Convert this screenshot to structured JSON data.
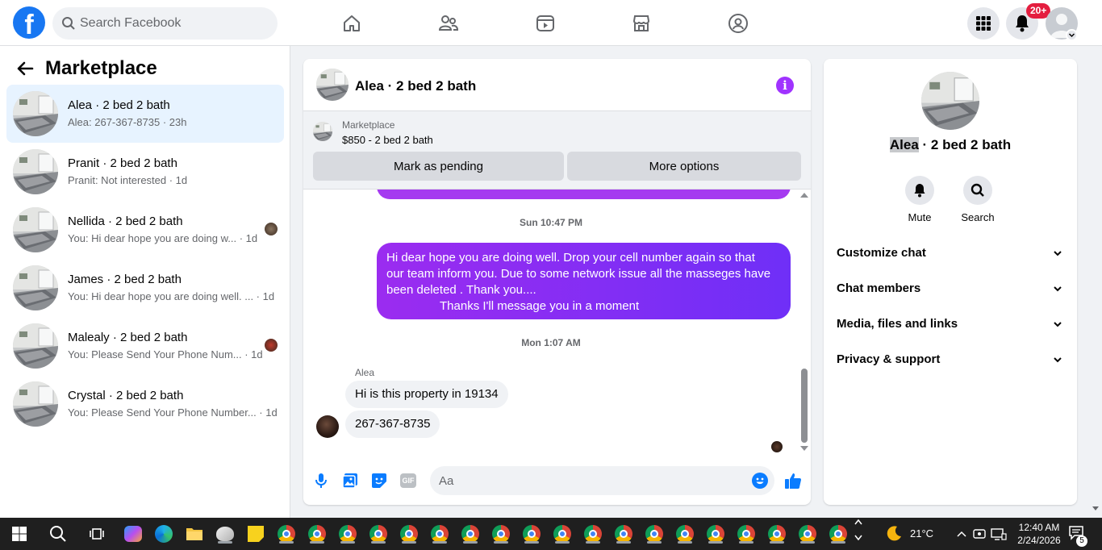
{
  "topbar": {
    "logo_letter": "f",
    "search_placeholder": "Search Facebook",
    "nav_icons": [
      "home-icon",
      "friends-icon",
      "video-icon",
      "marketplace-icon",
      "groups-icon"
    ],
    "notifications_badge": "20+",
    "colors": {
      "brand": "#1877f2",
      "badge": "#e41e3f"
    }
  },
  "sidebar": {
    "title": "Marketplace",
    "conversations": [
      {
        "title": "Alea · 2 bed 2 bath",
        "subtitle": "Alea: 267-367-8735 · 23h",
        "active": true
      },
      {
        "title": "Pranit · 2 bed 2 bath",
        "subtitle": "Pranit: Not interested · 1d"
      },
      {
        "title": "Nellida · 2 bed 2 bath",
        "subtitle": "You: Hi dear hope you are doing w... · 1d"
      },
      {
        "title": "James · 2 bed 2 bath",
        "subtitle": "You: Hi dear hope you are doing well. ... · 1d"
      },
      {
        "title": "Malealy · 2 bed 2 bath",
        "subtitle": "You: Please Send Your Phone Num... · 1d"
      },
      {
        "title": "Crystal · 2 bed 2 bath",
        "subtitle": "You: Please Send Your Phone Number... · 1d"
      }
    ]
  },
  "chat": {
    "title": "Alea · 2 bed 2 bath",
    "listing": {
      "source": "Marketplace",
      "price_title": "$850 - 2 bed 2 bath",
      "mark_pending_label": "Mark as pending",
      "more_options_label": "More options"
    },
    "messages": {
      "timestamp_1": "Sun 10:47 PM",
      "outgoing_lines": [
        "Hi dear hope you are doing well.  Drop your cell number again so that",
        "our team  inform you.  Due to some network issue all the masseges have",
        "been deleted . Thank you....",
        "Thanks I'll message you in a moment"
      ],
      "timestamp_2": "Mon 1:07 AM",
      "sender_name": "Alea",
      "incoming": [
        "Hi is this property in 19134",
        "267-367-8735"
      ]
    },
    "composer": {
      "placeholder": "Aa",
      "icons": [
        "microphone-icon",
        "photo-icon",
        "sticker-icon",
        "gif-icon",
        "emoji-icon",
        "like-icon"
      ],
      "gif_label": "GIF"
    },
    "colors": {
      "accent": "#a033ff",
      "outgoing_start": "#9b2cf0",
      "outgoing_end": "#6f2ff7"
    }
  },
  "right_panel": {
    "name_first": "Alea",
    "name_rest": " · 2 bed 2 bath",
    "actions": [
      {
        "label": "Mute",
        "icon": "bell-icon"
      },
      {
        "label": "Search",
        "icon": "search-icon"
      }
    ],
    "sections": [
      "Customize chat",
      "Chat members",
      "Media, files and links",
      "Privacy & support"
    ]
  },
  "taskbar": {
    "weather": "21°C",
    "time": "12:40 AM",
    "date": "2/24/2026",
    "notification_count": "5"
  }
}
